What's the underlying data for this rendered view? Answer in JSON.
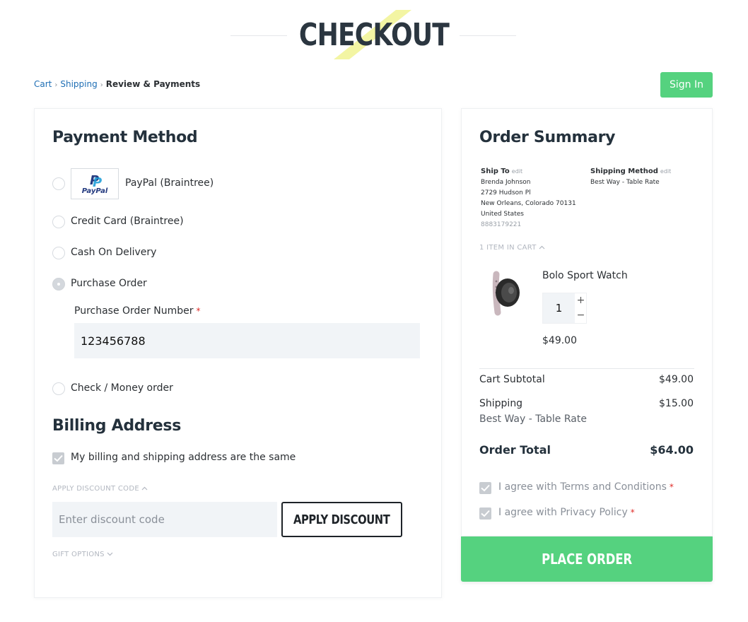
{
  "header": {
    "title": "CHECKOUT"
  },
  "breadcrumbs": [
    {
      "label": "Cart"
    },
    {
      "label": "Shipping"
    },
    {
      "label": "Review & Payments"
    }
  ],
  "sign_in_label": "Sign In",
  "payment": {
    "title": "Payment Method",
    "paypal_logo_text": "PayPal",
    "options": [
      {
        "label": "PayPal (Braintree)",
        "selected": false
      },
      {
        "label": "Credit Card (Braintree)",
        "selected": false
      },
      {
        "label": "Cash On Delivery",
        "selected": false
      },
      {
        "label": "Purchase Order",
        "selected": true
      },
      {
        "label": "Check / Money order",
        "selected": false
      }
    ],
    "po_number_label": "Purchase Order Number",
    "required_mark": "*",
    "po_number_value": "123456788"
  },
  "billing": {
    "title": "Billing Address",
    "same_address_label": "My billing and shipping address are the same",
    "same_address_checked": true
  },
  "discount": {
    "toggle_label": "APPLY DISCOUNT CODE",
    "placeholder": "Enter discount code",
    "button_label": "APPLY DISCOUNT"
  },
  "gift_options_label": "GIFT OPTIONS",
  "summary": {
    "title": "Order Summary",
    "ship_to": {
      "heading": "Ship To",
      "edit_label": "edit",
      "name": "Brenda Johnson",
      "street": "2729 Hudson Pl",
      "city_line": "New Orleans, Colorado 70131",
      "country": "United States",
      "phone": "8883179221"
    },
    "shipping_method": {
      "heading": "Shipping Method",
      "edit_label": "edit",
      "value": "Best Way - Table Rate"
    },
    "items_in_cart_label": "1 ITEM IN CART",
    "item": {
      "name": "Bolo Sport Watch",
      "qty": "1",
      "price": "$49.00"
    },
    "subtotal_label": "Cart Subtotal",
    "subtotal_value": "$49.00",
    "shipping_label": "Shipping",
    "shipping_value": "$15.00",
    "shipping_method_text": "Best Way - Table Rate",
    "total_label": "Order Total",
    "total_value": "$64.00",
    "agree_terms": "I agree with Terms and Conditions",
    "agree_privacy": "I agree with Privacy Policy"
  },
  "place_order_label": "PLACE ORDER",
  "colors": {
    "accent_green": "#55d27f",
    "link_blue": "#1f6fb5",
    "title_stripe": "#f0f2a0"
  }
}
